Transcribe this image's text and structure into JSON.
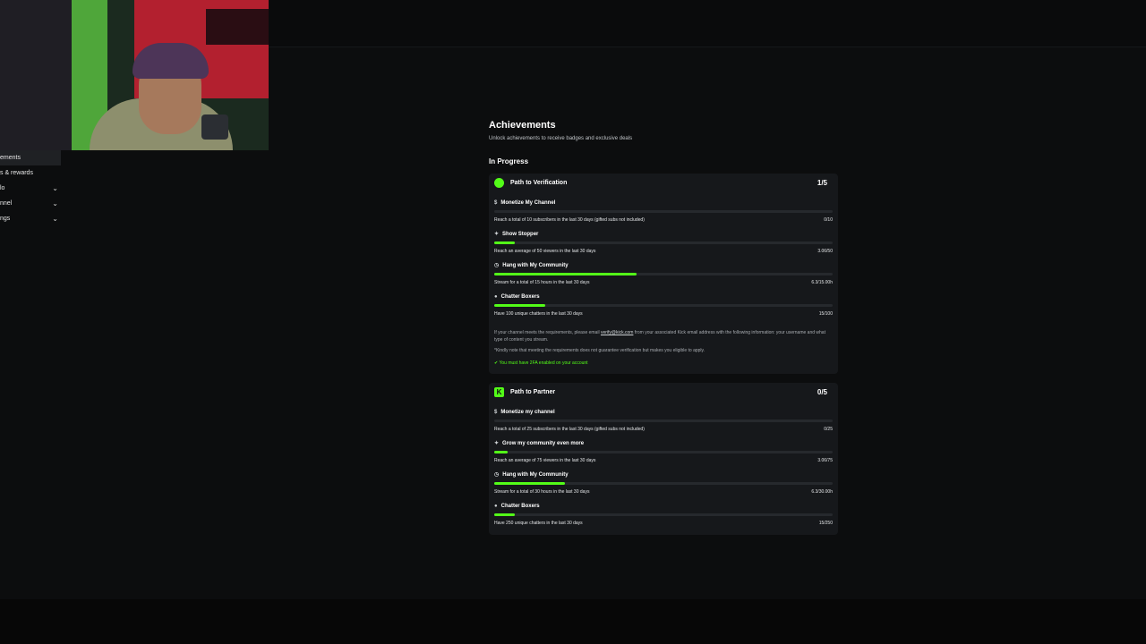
{
  "sidebar": {
    "items": [
      {
        "label": "ements",
        "active": true
      },
      {
        "label": "s & rewards"
      },
      {
        "label": "lo"
      },
      {
        "label": "nnel"
      },
      {
        "label": "ngs"
      }
    ]
  },
  "page": {
    "title": "Achievements",
    "subtitle": "Unlock achievements to receive badges and exclusive deals",
    "section": "In Progress"
  },
  "verification": {
    "title": "Path to Verification",
    "count": "1/5",
    "items": [
      {
        "icon": "dollar-icon",
        "title": "Monetize My Channel",
        "desc": "Reach a total of 10 subscribers in the last 30 days (gifted subs not included)",
        "value": "0/10",
        "progress": 0.0
      },
      {
        "icon": "star-icon",
        "title": "Show Stopper",
        "desc": "Reach an average of 50 viewers in the last 30 days",
        "value": "3.06/50",
        "progress": 0.061
      },
      {
        "icon": "clock-icon",
        "title": "Hang with My Community",
        "desc": "Stream for a total of 15 hours in the last 30 days",
        "value": "6.3/15.00h",
        "progress": 0.42
      },
      {
        "icon": "chat-icon",
        "title": "Chatter Boxers",
        "desc": "Have 100 unique chatters in the last 30 days",
        "value": "15/100",
        "progress": 0.15
      }
    ],
    "note_before_link": "If your channel meets the requirements, please email ",
    "note_link": "verify@kick.com",
    "note_after_link": " from your associated Kick email address with the following information: your username and what type of content you stream.",
    "note2": "*Kindly note that meeting the requirements does not guarantee verification but makes you eligible to apply.",
    "twofa": "You must have 2FA enabled on your account"
  },
  "partner": {
    "title": "Path to Partner",
    "count": "0/5",
    "items": [
      {
        "icon": "dollar-icon",
        "title": "Monetize my channel",
        "desc": "Reach a total of 25 subscribers in the last 30 days (gifted subs not included)",
        "value": "0/25",
        "progress": 0.0
      },
      {
        "icon": "star-icon",
        "title": "Grow my community even more",
        "desc": "Reach an average of 75 viewers in the last 30 days",
        "value": "3.06/75",
        "progress": 0.041
      },
      {
        "icon": "clock-icon",
        "title": "Hang with My Community",
        "desc": "Stream for a total of 30 hours in the last 30 days",
        "value": "6.3/30.00h",
        "progress": 0.21
      },
      {
        "icon": "chat-icon",
        "title": "Chatter Boxers",
        "desc": "Have 250 unique chatters in the last 30 days",
        "value": "15/250",
        "progress": 0.06
      }
    ]
  },
  "colors": {
    "accent": "#53fc18",
    "background": "#0c0d0e",
    "card": "#16181b"
  }
}
